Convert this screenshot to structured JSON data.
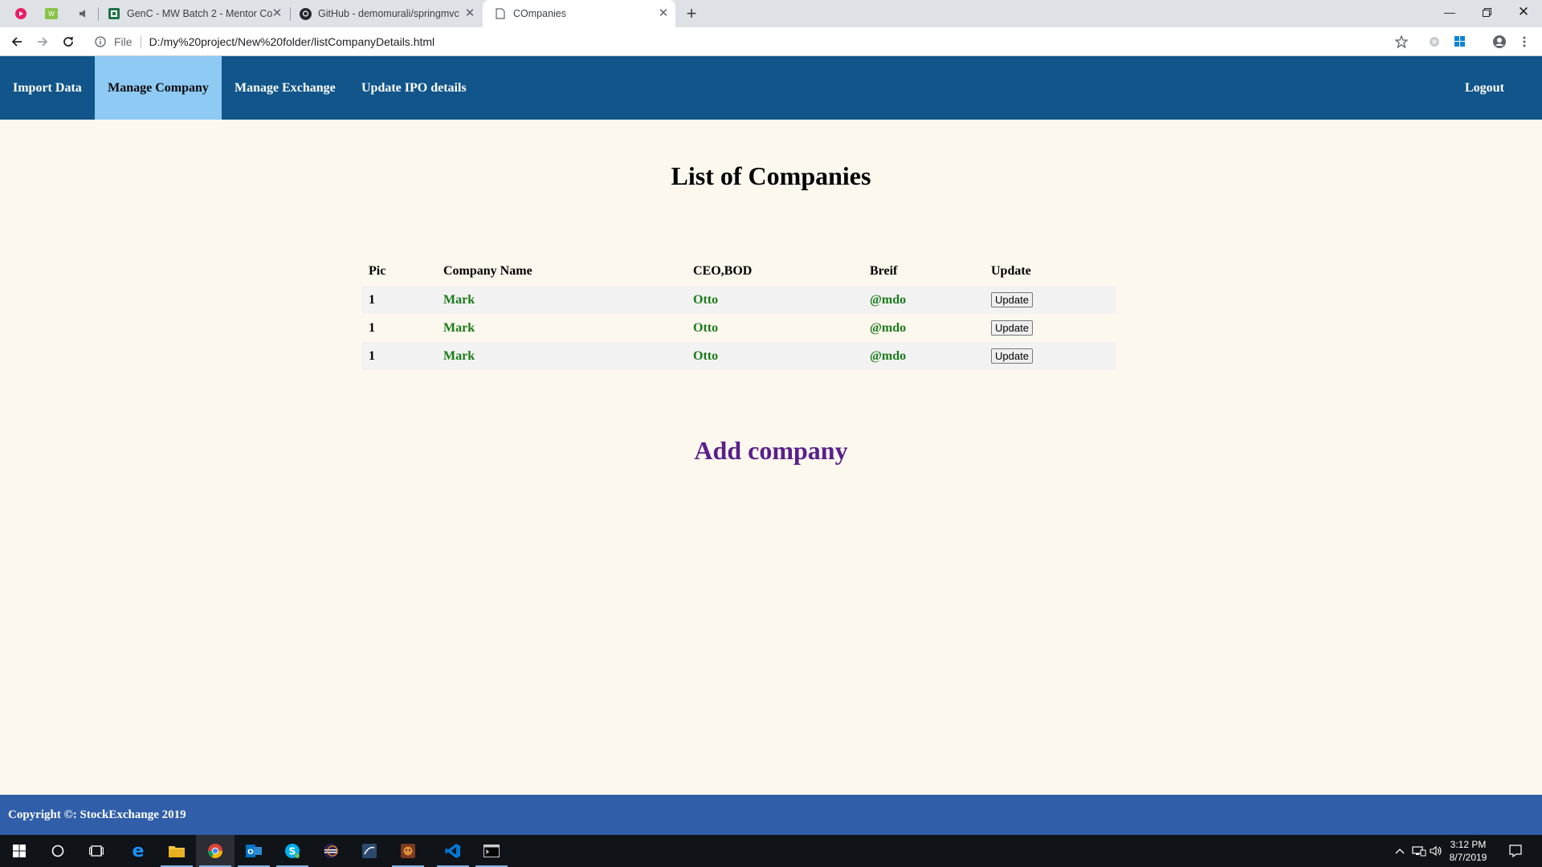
{
  "browser": {
    "tabs": [
      {
        "title": "GenC - MW Batch 2 - Mentor Co",
        "icon": "spreadsheet-icon"
      },
      {
        "title": "GitHub - demomurali/springmvc",
        "icon": "github-icon"
      },
      {
        "title": "COmpanies",
        "icon": "page-icon"
      }
    ],
    "url_scheme": "File",
    "url": "D:/my%20project/New%20folder/listCompanyDetails.html"
  },
  "nav": {
    "items": [
      "Import Data",
      "Manage Company",
      "Manage Exchange",
      "Update IPO details"
    ],
    "active": "Manage Company",
    "logout": "Logout"
  },
  "page": {
    "title": "List of Companies",
    "table": {
      "headers": [
        "Pic",
        "Company Name",
        "CEO,BOD",
        "Breif",
        "Update"
      ],
      "rows": [
        {
          "pic": "1",
          "name": "Mark",
          "ceo": "Otto",
          "brief": "@mdo",
          "button": "Update"
        },
        {
          "pic": "1",
          "name": "Mark",
          "ceo": "Otto",
          "brief": "@mdo",
          "button": "Update"
        },
        {
          "pic": "1",
          "name": "Mark",
          "ceo": "Otto",
          "brief": "@mdo",
          "button": "Update"
        }
      ]
    },
    "add_link": "Add company"
  },
  "footer": {
    "text": "Copyright ©: StockExchange 2019"
  },
  "taskbar": {
    "time": "3:12 PM",
    "date": "8/7/2019"
  },
  "colors": {
    "navbar": "#11558a",
    "active_nav": "#8ecaf4",
    "page_bg": "#fdf8ee",
    "footer": "#305ea8",
    "cell_text": "#1a7a1a",
    "add_link": "#5a1f8a"
  }
}
